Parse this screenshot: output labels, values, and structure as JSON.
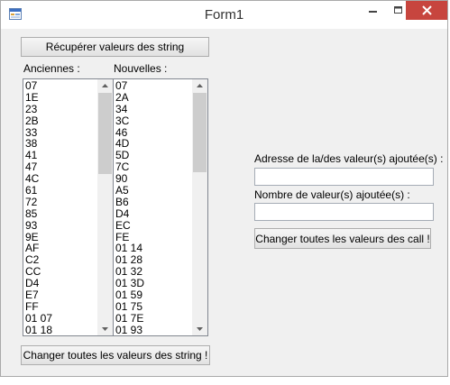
{
  "window": {
    "title": "Form1"
  },
  "buttons": {
    "get_strings": "Récupérer valeurs des string",
    "change_strings": "Changer toutes les valeurs des string !",
    "change_calls": "Changer toutes les valeurs des call !"
  },
  "lists": {
    "old_label": "Anciennes :",
    "new_label": "Nouvelles :",
    "old_items": [
      "07",
      "1E",
      "23",
      "2B",
      "33",
      "38",
      "41",
      "47",
      "4C",
      "61",
      "72",
      "85",
      "93",
      "9E",
      "AF",
      "C2",
      "CC",
      "D4",
      "E7",
      "FF",
      "01 07",
      "01 18"
    ],
    "new_items": [
      "07",
      "2A",
      "34",
      "3C",
      "46",
      "4D",
      "5D",
      "7C",
      "90",
      "A5",
      "B6",
      "D4",
      "EC",
      "FE",
      "01 14",
      "01 28",
      "01 32",
      "01 3D",
      "01 59",
      "01 75",
      "01 7E",
      "01 93"
    ],
    "old_scroll_position": 0,
    "new_scroll_position": 0
  },
  "form": {
    "address_label": "Adresse de la/des valeur(s) ajoutée(s) :",
    "address_value": "",
    "count_label": "Nombre de valeur(s) ajoutée(s) :",
    "count_value": ""
  }
}
